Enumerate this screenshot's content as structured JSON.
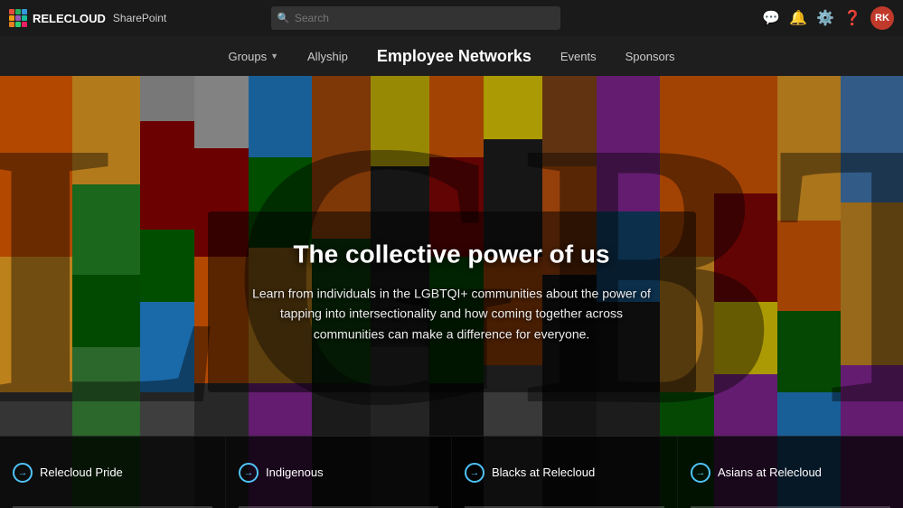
{
  "app": {
    "name": "RELECLOUD",
    "platform": "SharePoint"
  },
  "topbar": {
    "search_placeholder": "Search",
    "icons": [
      "feedback-icon",
      "notifications-icon",
      "settings-icon",
      "help-icon"
    ],
    "avatar_initials": "RK"
  },
  "nav": {
    "items": [
      {
        "label": "Groups",
        "has_dropdown": true,
        "active": false
      },
      {
        "label": "Allyship",
        "has_dropdown": false,
        "active": false
      },
      {
        "label": "Employee Networks",
        "has_dropdown": false,
        "active": true
      },
      {
        "label": "Events",
        "has_dropdown": false,
        "active": false
      },
      {
        "label": "Sponsors",
        "has_dropdown": false,
        "active": false
      }
    ]
  },
  "hero": {
    "title": "The collective power of us",
    "subtitle": "Learn from individuals in the LGBTQI+ communities about the power of tapping into intersectionality and how coming together across communities can make a difference for everyone."
  },
  "cards": [
    {
      "label": "Relecloud Pride"
    },
    {
      "label": "Indigenous"
    },
    {
      "label": "Blacks at Relecloud"
    },
    {
      "label": "Asians at Relecloud"
    }
  ]
}
